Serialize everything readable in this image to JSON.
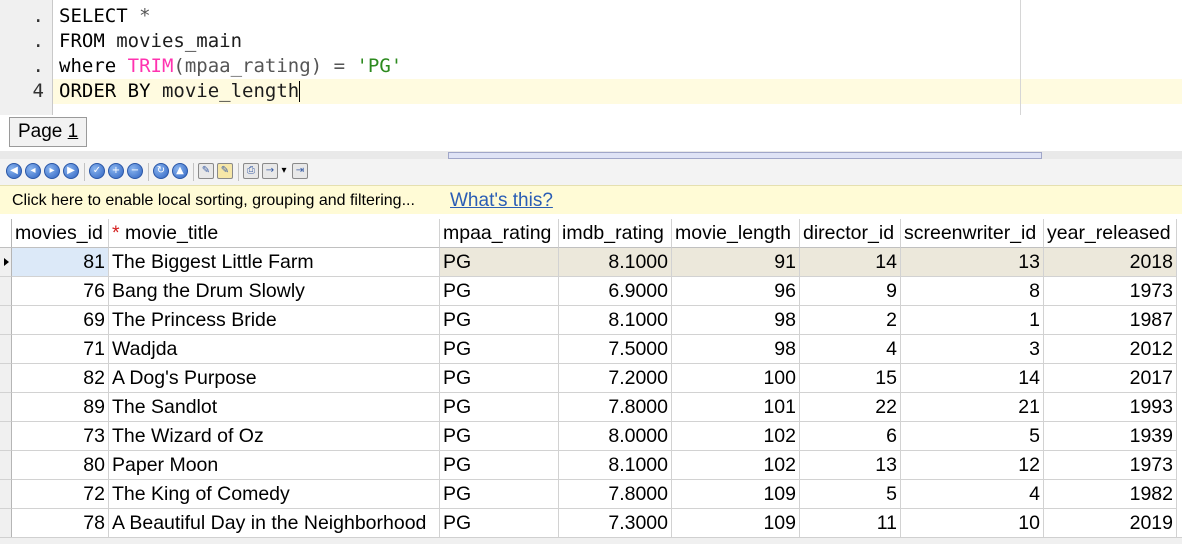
{
  "editor": {
    "line_numbers": [
      ".",
      ".",
      ".",
      "4"
    ],
    "lines": [
      [
        {
          "t": "SELECT",
          "c": "kw"
        },
        {
          "t": " *",
          "c": "paren"
        }
      ],
      [
        {
          "t": "FROM",
          "c": "kw"
        },
        {
          "t": " movies_main",
          "c": "ident"
        }
      ],
      [
        {
          "t": "where",
          "c": "kw"
        },
        {
          "t": " ",
          "c": "ident"
        },
        {
          "t": "TRIM",
          "c": "fn"
        },
        {
          "t": "(mpaa_rating) = ",
          "c": "paren"
        },
        {
          "t": "'PG'",
          "c": "str"
        }
      ],
      [
        {
          "t": "ORDER BY",
          "c": "kw"
        },
        {
          "t": " movie_length",
          "c": "ident"
        }
      ]
    ]
  },
  "pager": {
    "label": "Page",
    "number": "1"
  },
  "toolbar": {
    "buttons": [
      "first-record-icon",
      "prev-record-icon",
      "next-record-icon",
      "last-record-icon",
      "post-icon",
      "insert-icon",
      "delete-icon",
      "refresh-icon",
      "cancel-icon",
      "edit-icon",
      "edit-mode-icon",
      "print-icon",
      "export-icon",
      "export-dropdown-icon",
      "import-icon"
    ]
  },
  "infobar": {
    "text": "Click here to enable local sorting, grouping and filtering...",
    "link": "What's this?"
  },
  "grid": {
    "columns": [
      "movies_id",
      "movie_title",
      "mpaa_rating",
      "imdb_rating",
      "movie_length",
      "director_id",
      "screenwriter_id",
      "year_released"
    ],
    "required_marker": "*",
    "rows": [
      [
        "81",
        "The Biggest Little Farm",
        "PG",
        "8.1000",
        "91",
        "14",
        "13",
        "2018"
      ],
      [
        "76",
        "Bang the Drum Slowly",
        "PG",
        "6.9000",
        "96",
        "9",
        "8",
        "1973"
      ],
      [
        "69",
        "The Princess Bride",
        "PG",
        "8.1000",
        "98",
        "2",
        "1",
        "1987"
      ],
      [
        "71",
        "Wadjda",
        "PG",
        "7.5000",
        "98",
        "4",
        "3",
        "2012"
      ],
      [
        "82",
        "A Dog's Purpose",
        "PG",
        "7.2000",
        "100",
        "15",
        "14",
        "2017"
      ],
      [
        "89",
        "The Sandlot",
        "PG",
        "7.8000",
        "101",
        "22",
        "21",
        "1993"
      ],
      [
        "73",
        "The Wizard of Oz",
        "PG",
        "8.0000",
        "102",
        "6",
        "5",
        "1939"
      ],
      [
        "80",
        "Paper Moon",
        "PG",
        "8.1000",
        "102",
        "13",
        "12",
        "1973"
      ],
      [
        "72",
        "The King of Comedy",
        "PG",
        "7.8000",
        "109",
        "5",
        "4",
        "1982"
      ],
      [
        "78",
        "A Beautiful Day in the Neighborhood",
        "PG",
        "7.3000",
        "109",
        "11",
        "10",
        "2019"
      ]
    ]
  },
  "colors": {
    "string": "#2c8a1e",
    "function": "#ff33b0",
    "link": "#2a5db5",
    "info_bg": "#fffbd6",
    "selected_row": "#ece8db"
  }
}
